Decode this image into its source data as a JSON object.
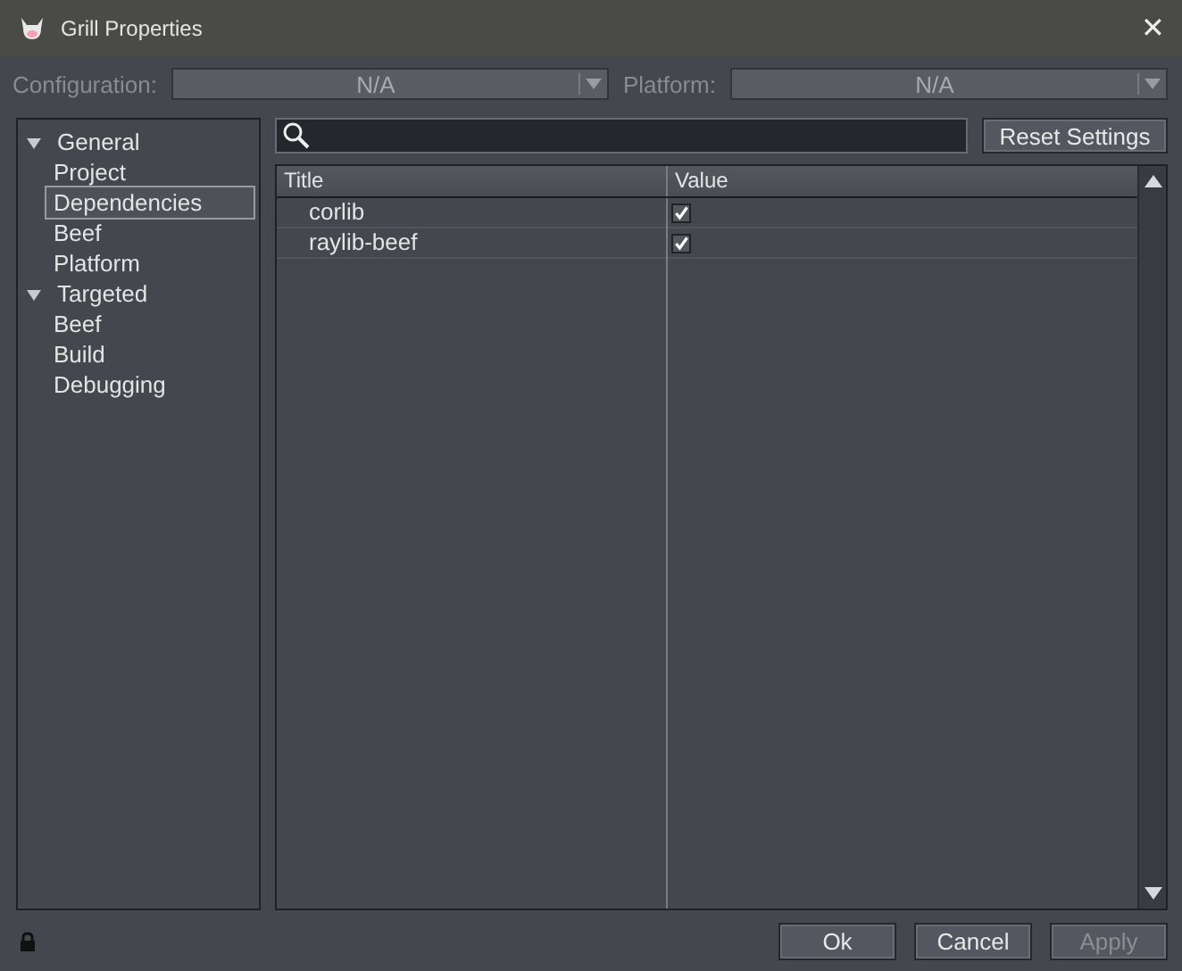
{
  "window": {
    "title": "Grill Properties",
    "close": "✕"
  },
  "configuration": {
    "label": "Configuration:",
    "value": "N/A",
    "disabled": true
  },
  "platform": {
    "label": "Platform:",
    "value": "N/A",
    "disabled": true
  },
  "sidebar": {
    "items": [
      {
        "label": "General",
        "expanded": true,
        "selected": false,
        "children": [
          {
            "label": "Project",
            "selected": false
          },
          {
            "label": "Dependencies",
            "selected": true
          },
          {
            "label": "Beef",
            "selected": false
          },
          {
            "label": "Platform",
            "selected": false
          }
        ]
      },
      {
        "label": "Targeted",
        "expanded": true,
        "selected": false,
        "children": [
          {
            "label": "Beef",
            "selected": false
          },
          {
            "label": "Build",
            "selected": false
          },
          {
            "label": "Debugging",
            "selected": false
          }
        ]
      }
    ]
  },
  "reset_button": "Reset Settings",
  "table": {
    "columns": [
      "Title",
      "Value"
    ],
    "rows": [
      {
        "title": "corlib",
        "checked": true
      },
      {
        "title": "raylib-beef",
        "checked": true
      }
    ]
  },
  "buttons": [
    {
      "label": "Ok",
      "disabled": false
    },
    {
      "label": "Cancel",
      "disabled": false
    },
    {
      "label": "Apply",
      "disabled": true
    }
  ]
}
